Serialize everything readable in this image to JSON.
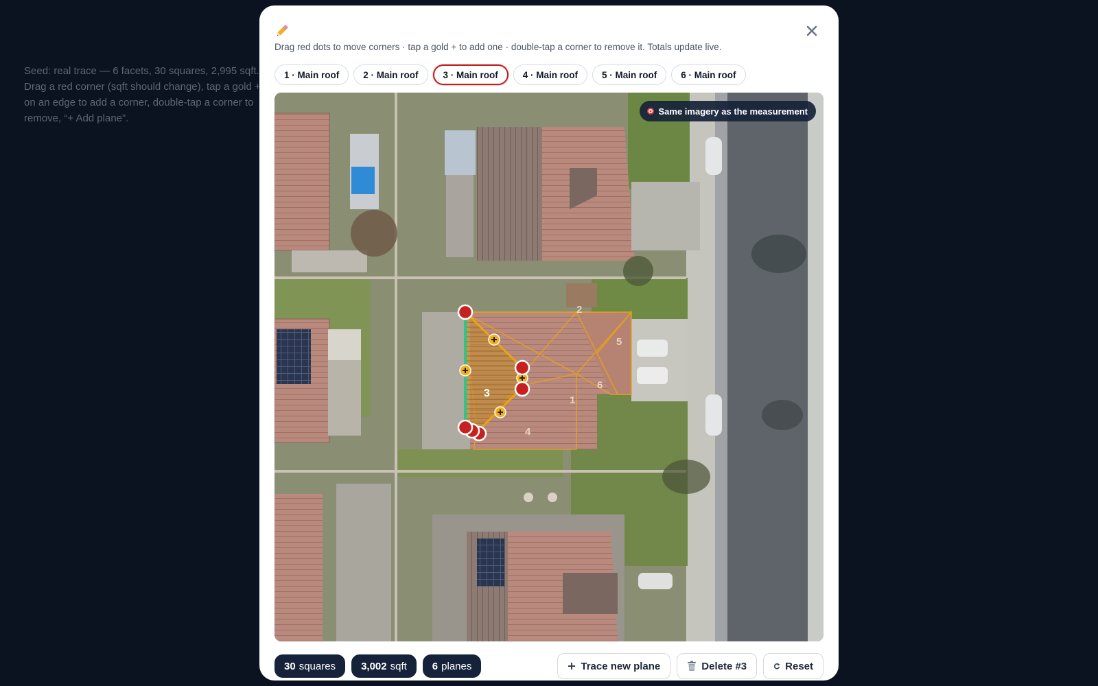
{
  "background": {
    "note": "Seed: real trace — 6 facets, 30 squares, 2,995 sqft. Drag a red corner (sqft should change), tap a gold + on an edge to add a corner, double-tap a corner to remove, “+ Add plane”."
  },
  "modal": {
    "title_icon": "pencil-icon",
    "instructions": "Drag red dots to move corners · tap a gold + to add one · double-tap a corner to remove it. Totals update live.",
    "close_icon": "close-icon"
  },
  "tabs": [
    {
      "label": "1 · Main roof",
      "active": false
    },
    {
      "label": "2 · Main roof",
      "active": false
    },
    {
      "label": "3 · Main roof",
      "active": true
    },
    {
      "label": "4 · Main roof",
      "active": false
    },
    {
      "label": "5 · Main roof",
      "active": false
    },
    {
      "label": "6 · Main roof",
      "active": false
    }
  ],
  "map": {
    "badge_label": "Same imagery as the measurement",
    "badge_icon": "target-icon",
    "facet_labels": [
      "1",
      "2",
      "3",
      "4",
      "5",
      "6"
    ],
    "selected_facet": "3"
  },
  "stats": {
    "squares_value": "30",
    "squares_unit": "squares",
    "area_value": "3,002",
    "area_unit": "sqft",
    "planes_value": "6",
    "planes_unit": "planes"
  },
  "actions": {
    "trace_label": "Trace new plane",
    "delete_label": "Delete #3",
    "reset_label": "Reset"
  },
  "colors": {
    "selected_outline": "#e8a317",
    "corner_dot": "#c62020",
    "active_edge": "#2fc48a",
    "active_tab_border": "#c21f1f",
    "stat_pill": "#16223a"
  }
}
